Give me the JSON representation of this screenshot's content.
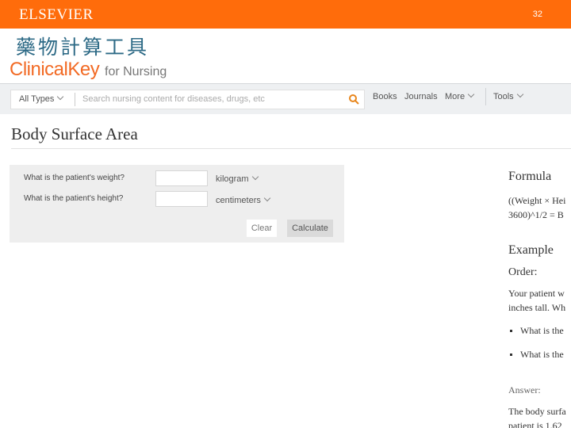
{
  "slide": {
    "publisher": "ELSEVIER",
    "page_number": "32",
    "title": "藥物計算工具"
  },
  "logo": {
    "brand": "ClinicalKey",
    "suffix": "for Nursing"
  },
  "search": {
    "scope": "All Types",
    "placeholder": "Search nursing content for diseases, drugs, etc",
    "nav": [
      "Books",
      "Journals",
      "More",
      "Tools"
    ]
  },
  "page": {
    "heading": "Body Surface Area"
  },
  "calculator": {
    "weight_label": "What is the patient's weight?",
    "weight_value": "",
    "weight_unit": "kilogram",
    "height_label": "What is the patient's height?",
    "height_value": "",
    "height_unit": "centimeters",
    "clear_label": "Clear",
    "calculate_label": "Calculate"
  },
  "sidebar": {
    "formula_heading": "Formula",
    "formula_line1": "((Weight × Hei",
    "formula_line2": "3600)^1/2 = B",
    "example_heading": "Example",
    "order_label": "Order:",
    "example_line1": "Your patient w",
    "example_line2": "inches tall. Wh",
    "bullets": [
      "What is the",
      "What is the"
    ],
    "answer_label": "Answer:",
    "answer_line1": "The body surfa",
    "answer_line2": "patient is 1.62"
  },
  "colors": {
    "header_orange": "#ff6c0b",
    "title_blue": "#2d6a86",
    "logo_orange": "#f26a24"
  }
}
